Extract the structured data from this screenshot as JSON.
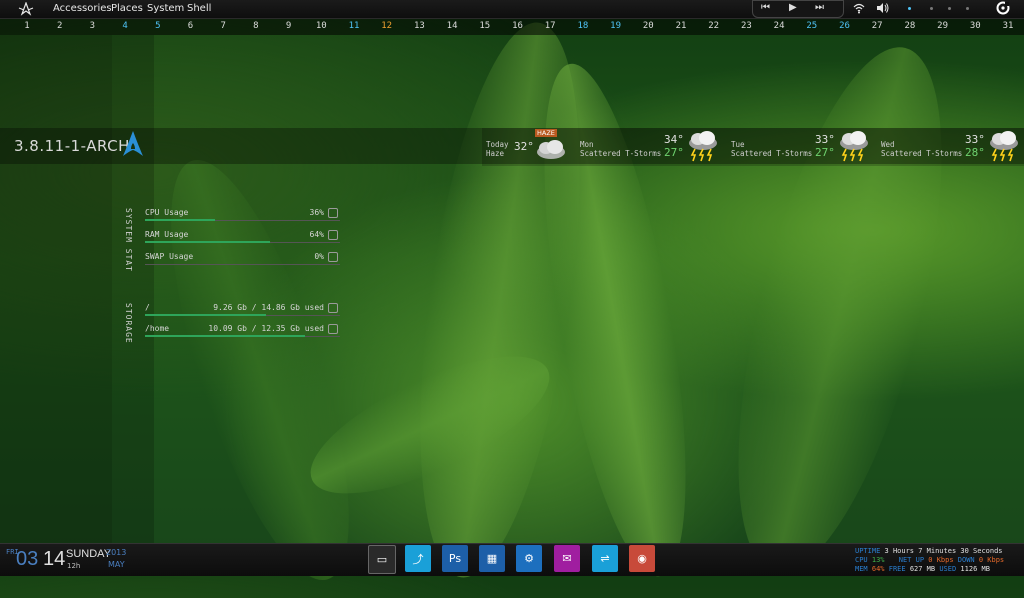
{
  "menu": {
    "items": [
      "Accessories",
      "Places",
      "System",
      "Shell"
    ]
  },
  "media": {
    "prev": "⏮",
    "play": "▶",
    "next": "⏭"
  },
  "workspaces": [
    {
      "label": "1",
      "color": "#dcdcdc"
    },
    {
      "label": "2",
      "color": "#dcdcdc"
    },
    {
      "label": "3",
      "color": "#dcdcdc"
    },
    {
      "label": "4",
      "color": "#4fc3f7"
    },
    {
      "label": "5",
      "color": "#4fc3f7"
    },
    {
      "label": "6",
      "color": "#dcdcdc"
    },
    {
      "label": "7",
      "color": "#dcdcdc"
    },
    {
      "label": "8",
      "color": "#dcdcdc"
    },
    {
      "label": "9",
      "color": "#dcdcdc"
    },
    {
      "label": "10",
      "color": "#dcdcdc"
    },
    {
      "label": "11",
      "color": "#4fc3f7"
    },
    {
      "label": "12",
      "color": "#f0a030"
    },
    {
      "label": "13",
      "color": "#dcdcdc"
    },
    {
      "label": "14",
      "color": "#dcdcdc"
    },
    {
      "label": "15",
      "color": "#dcdcdc"
    },
    {
      "label": "16",
      "color": "#dcdcdc"
    },
    {
      "label": "17",
      "color": "#dcdcdc"
    },
    {
      "label": "18",
      "color": "#4fc3f7"
    },
    {
      "label": "19",
      "color": "#4fc3f7"
    },
    {
      "label": "20",
      "color": "#dcdcdc"
    },
    {
      "label": "21",
      "color": "#dcdcdc"
    },
    {
      "label": "22",
      "color": "#dcdcdc"
    },
    {
      "label": "23",
      "color": "#dcdcdc"
    },
    {
      "label": "24",
      "color": "#dcdcdc"
    },
    {
      "label": "25",
      "color": "#4fc3f7"
    },
    {
      "label": "26",
      "color": "#4fc3f7"
    },
    {
      "label": "27",
      "color": "#dcdcdc"
    },
    {
      "label": "28",
      "color": "#dcdcdc"
    },
    {
      "label": "29",
      "color": "#dcdcdc"
    },
    {
      "label": "30",
      "color": "#dcdcdc"
    },
    {
      "label": "31",
      "color": "#dcdcdc"
    }
  ],
  "kernel": "3.8.11-1-ARCH",
  "weather": {
    "today": {
      "day": "Today",
      "cond": "Haze",
      "temp": "32°",
      "badge": "HAZE"
    },
    "days": [
      {
        "day": "Mon",
        "cond": "Scattered T-Storms",
        "hi": "34°",
        "lo": "27°"
      },
      {
        "day": "Tue",
        "cond": "Scattered T-Storms",
        "hi": "33°",
        "lo": "27°"
      },
      {
        "day": "Wed",
        "cond": "Scattered T-Storms",
        "hi": "33°",
        "lo": "28°"
      }
    ]
  },
  "system_stat": {
    "title": "SYSTEM STAT",
    "rows": [
      {
        "label": "CPU Usage",
        "value": "36%",
        "percent": 36
      },
      {
        "label": "RAM Usage",
        "value": "64%",
        "percent": 64
      },
      {
        "label": "SWAP Usage",
        "value": "0%",
        "percent": 0
      }
    ]
  },
  "storage": {
    "title": "STORAGE",
    "rows": [
      {
        "label": "/",
        "value": "9.26 Gb / 14.86 Gb used",
        "percent": 62
      },
      {
        "label": "/home",
        "value": "10.09 Gb / 12.35 Gb used",
        "percent": 82
      }
    ]
  },
  "clock": {
    "dow_short": "FRI",
    "day": "03",
    "date": "14",
    "weekday": "SUNDAY",
    "time": "12h",
    "year": "2013",
    "month": "MAY"
  },
  "launchers": [
    {
      "name": "terminal",
      "glyph": "▭",
      "bg": "#2a2a2a"
    },
    {
      "name": "files",
      "glyph": "⤴",
      "bg": "#1aa0d8"
    },
    {
      "name": "photoshop",
      "glyph": "Ps",
      "bg": "#1d5fa8"
    },
    {
      "name": "calculator",
      "glyph": "▦",
      "bg": "#1d5fa8"
    },
    {
      "name": "settings",
      "glyph": "⚙",
      "bg": "#1d6fbe"
    },
    {
      "name": "chat",
      "glyph": "✉",
      "bg": "#a01ea0"
    },
    {
      "name": "usb",
      "glyph": "⇌",
      "bg": "#1aa0d8"
    },
    {
      "name": "chrome",
      "glyph": "◉",
      "bg": "#c84a3a"
    }
  ],
  "sysinfo": {
    "uptime_label": "UPTIME",
    "uptime_value": "3 Hours 7 Minutes 30 Seconds",
    "cpu_label": "CPU",
    "cpu_value": "13%",
    "net_label": "NET UP",
    "net_up": "0 Kbps",
    "down_label": "DOWN",
    "net_down": "0 Kbps",
    "mem_label": "MEM",
    "mem_value": "64%",
    "free_label": "FREE",
    "free_value": "627 MB",
    "used_label": "USED",
    "used_value": "1126 MB"
  }
}
